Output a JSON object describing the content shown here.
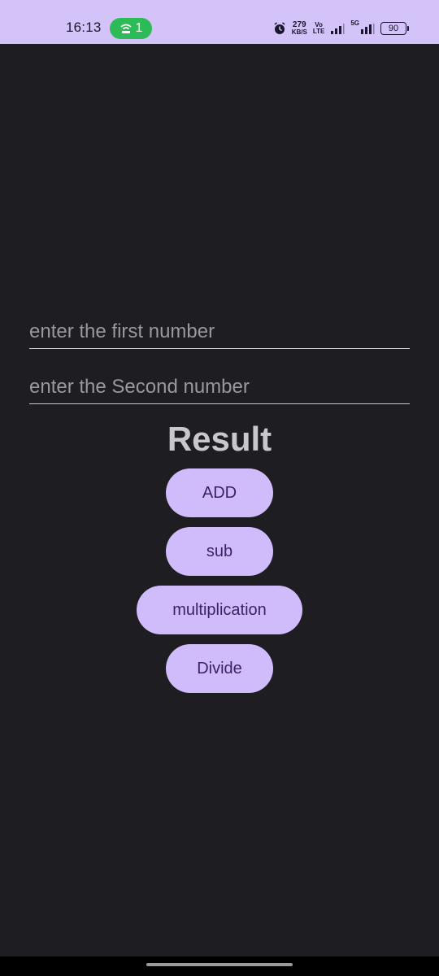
{
  "status_bar": {
    "time": "16:13",
    "hotspot_count": "1",
    "net_speed_value": "279",
    "net_speed_unit": "KB/S",
    "volte_top": "Vo",
    "volte_bottom": "LTE",
    "network_type": "5G",
    "battery_level": "90",
    "icons": [
      "hotspot-icon",
      "alarm-icon",
      "signal-icon",
      "signal-icon"
    ]
  },
  "form": {
    "first_placeholder": "enter the first number",
    "second_placeholder": "enter the Second number",
    "first_value": "",
    "second_value": ""
  },
  "result_label": "Result",
  "buttons": {
    "add": "ADD",
    "sub": "sub",
    "multiplication": "multiplication",
    "divide": "Divide"
  },
  "colors": {
    "status_bar_bg": "#d4c3f8",
    "background": "#1e1d21",
    "button_bg": "#d1bcfb",
    "button_text": "#3a2266",
    "hotspot_green": "#2dbb57"
  }
}
